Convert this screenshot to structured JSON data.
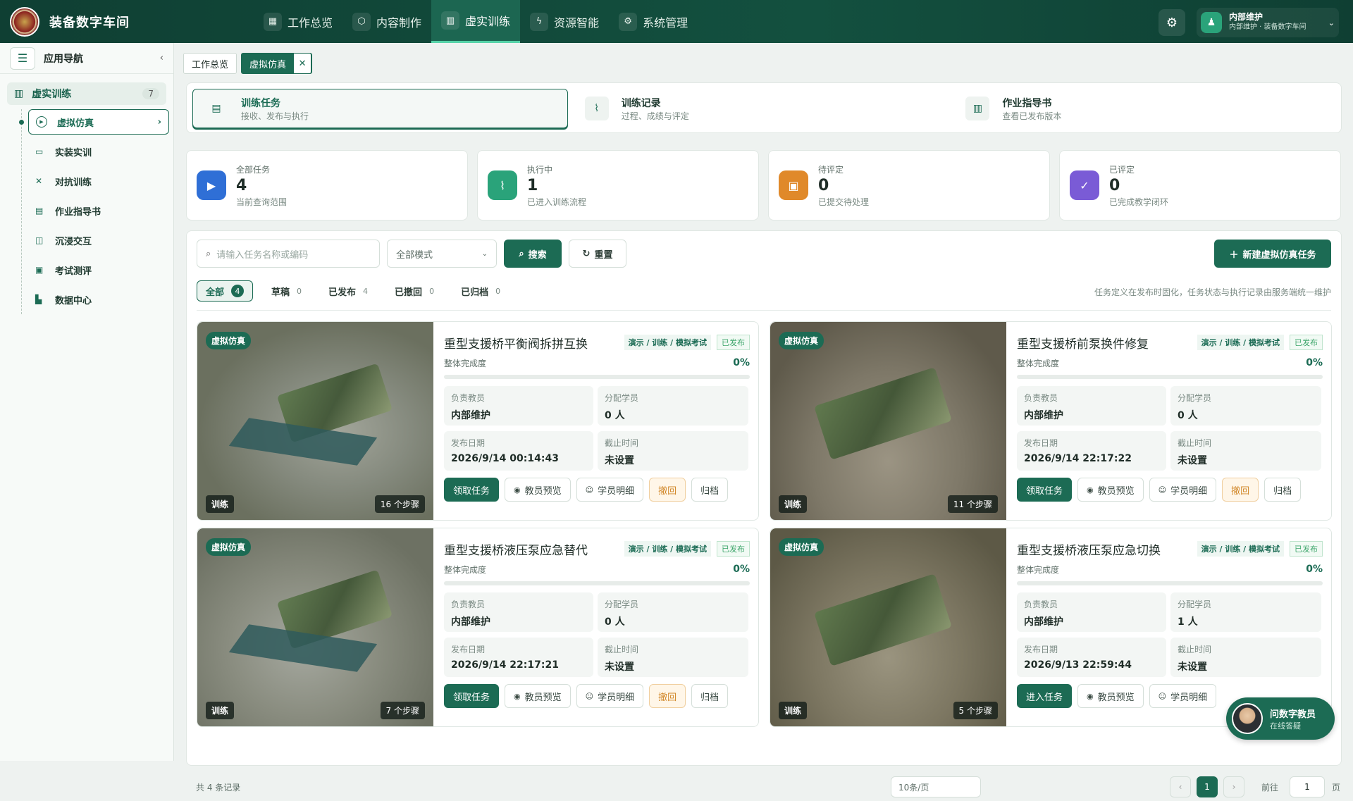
{
  "app": {
    "title": "装备数字车间"
  },
  "nav": [
    {
      "label": "工作总览",
      "icon": "grid-icon"
    },
    {
      "label": "内容制作",
      "icon": "cube-icon"
    },
    {
      "label": "虚实训练",
      "icon": "book-icon",
      "active": true
    },
    {
      "label": "资源智能",
      "icon": "bolt-icon"
    },
    {
      "label": "系统管理",
      "icon": "gear-icon"
    }
  ],
  "user": {
    "name": "内部维护",
    "sub": "内部维护 · 装备数字车间"
  },
  "sidebar": {
    "title": "应用导航",
    "group": {
      "label": "虚实训练",
      "count": "7"
    },
    "items": [
      {
        "label": "虚拟仿真",
        "active": true
      },
      {
        "label": "实装实训"
      },
      {
        "label": "对抗训练"
      },
      {
        "label": "作业指导书"
      },
      {
        "label": "沉浸交互"
      },
      {
        "label": "考试测评"
      },
      {
        "label": "数据中心"
      }
    ]
  },
  "tabs": {
    "t1": "工作总览",
    "t2": "虚拟仿真"
  },
  "modes": [
    {
      "title": "训练任务",
      "desc": "接收、发布与执行"
    },
    {
      "title": "训练记录",
      "desc": "过程、成绩与评定"
    },
    {
      "title": "作业指导书",
      "desc": "查看已发布版本"
    }
  ],
  "stats": [
    {
      "label": "全部任务",
      "value": "4",
      "desc": "当前查询范围",
      "color": "#2f6fd6"
    },
    {
      "label": "执行中",
      "value": "1",
      "desc": "已进入训练流程",
      "color": "#2aa37a"
    },
    {
      "label": "待评定",
      "value": "0",
      "desc": "已提交待处理",
      "color": "#e0892a"
    },
    {
      "label": "已评定",
      "value": "0",
      "desc": "已完成教学闭环",
      "color": "#7a5bd6"
    }
  ],
  "filter": {
    "search_placeholder": "请输入任务名称或编码",
    "mode": "全部模式",
    "search_btn": "搜索",
    "reset_btn": "重置",
    "new_btn": "新建虚拟仿真任务",
    "note": "任务定义在发布时固化，任务状态与执行记录由服务端统一维护"
  },
  "status_tabs": [
    {
      "label": "全部",
      "count": "4"
    },
    {
      "label": "草稿",
      "count": "0"
    },
    {
      "label": "已发布",
      "count": "4"
    },
    {
      "label": "已撤回",
      "count": "0"
    },
    {
      "label": "已归档",
      "count": "0"
    }
  ],
  "card_labels": {
    "tag": "虚拟仿真",
    "train": "训练",
    "progress": "整体完成度",
    "teacher": "负责教员",
    "students": "分配学员",
    "pub": "发布日期",
    "deadline": "截止时间",
    "preview": "教员预览",
    "detail": "学员明细",
    "withdraw": "撤回",
    "archive": "归档"
  },
  "cards": [
    {
      "title": "重型支援桥平衡阀拆拼互换",
      "modes": "演示 / 训练 / 模拟考试",
      "status": "已发布",
      "progress": "0%",
      "teacher": "内部维护",
      "students": "0 人",
      "pub": "2026/9/14 00:14:43",
      "deadline": "未设置",
      "steps": "16 个步骤",
      "action": "领取任务"
    },
    {
      "title": "重型支援桥前泵换件修复",
      "modes": "演示 / 训练 / 模拟考试",
      "status": "已发布",
      "progress": "0%",
      "teacher": "内部维护",
      "students": "0 人",
      "pub": "2026/9/14 22:17:22",
      "deadline": "未设置",
      "steps": "11 个步骤",
      "action": "领取任务"
    },
    {
      "title": "重型支援桥液压泵应急替代",
      "modes": "演示 / 训练 / 模拟考试",
      "status": "已发布",
      "progress": "0%",
      "teacher": "内部维护",
      "students": "0 人",
      "pub": "2026/9/14 22:17:21",
      "deadline": "未设置",
      "steps": "7 个步骤",
      "action": "领取任务"
    },
    {
      "title": "重型支援桥液压泵应急切换",
      "modes": "演示 / 训练 / 模拟考试",
      "status": "已发布",
      "progress": "0%",
      "teacher": "内部维护",
      "students": "1 人",
      "pub": "2026/9/13 22:59:44",
      "deadline": "未设置",
      "steps": "5 个步骤",
      "action": "进入任务"
    }
  ],
  "footer": {
    "total": "共 4 条记录",
    "page_size": "10条/页",
    "page": "1",
    "goto": "前往",
    "page_suffix": "页"
  },
  "assistant": {
    "title": "问数字教员",
    "sub": "在线答疑"
  }
}
